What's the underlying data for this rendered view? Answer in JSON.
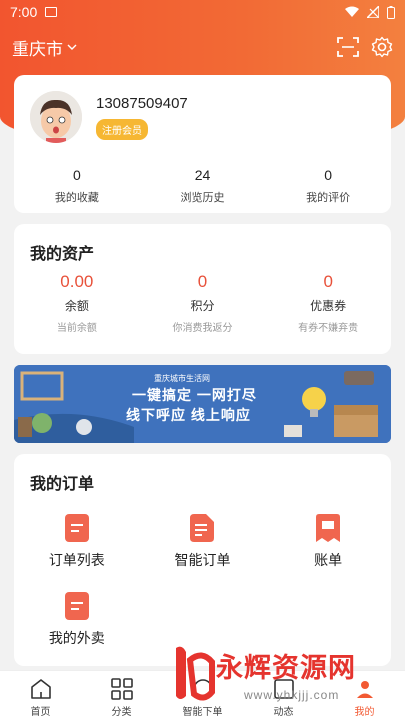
{
  "status_bar": {
    "time": "7:00"
  },
  "header": {
    "city": "重庆市"
  },
  "profile": {
    "phone": "13087509407",
    "badge": "注册会员",
    "stats": [
      {
        "value": "0",
        "label": "我的收藏"
      },
      {
        "value": "24",
        "label": "浏览历史"
      },
      {
        "value": "0",
        "label": "我的评价"
      }
    ]
  },
  "assets": {
    "title": "我的资产",
    "items": [
      {
        "value": "0.00",
        "label": "余额",
        "sub": "当前余额"
      },
      {
        "value": "0",
        "label": "积分",
        "sub": "你消费我返分"
      },
      {
        "value": "0",
        "label": "优惠券",
        "sub": "有券不嫌弃贵"
      }
    ]
  },
  "banner": {
    "brand": "重庆城市生活网",
    "line1": "一键搞定  一网打尽",
    "line2": "线下呼应  线上响应"
  },
  "orders": {
    "title": "我的订单",
    "items": [
      {
        "label": "订单列表"
      },
      {
        "label": "智能订单"
      },
      {
        "label": "账单"
      },
      {
        "label": "我的外卖"
      }
    ]
  },
  "tabbar": {
    "items": [
      {
        "label": "首页"
      },
      {
        "label": "分类"
      },
      {
        "label": "智能下单"
      },
      {
        "label": "动态"
      },
      {
        "label": "我的"
      }
    ]
  },
  "watermark": {
    "text": "永辉资源网",
    "url": "www.yhkjjj.com"
  },
  "colors": {
    "brand": "#f26a35",
    "accent": "#e8513a",
    "badge": "#f6b733"
  }
}
